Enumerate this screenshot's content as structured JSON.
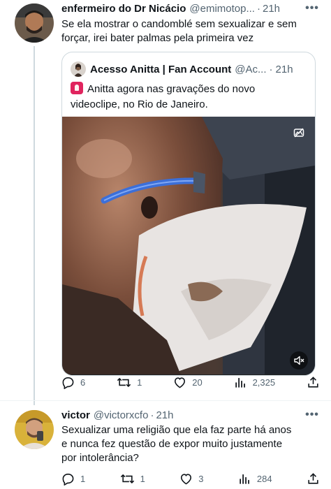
{
  "tweet1": {
    "display_name": "enfermeiro do Dr Nicácio",
    "handle": "@emimotop...",
    "dot": "·",
    "time": "21h",
    "text_line1": "Se ela mostrar o candomblé sem sexualizar e sem",
    "text_line2": "forçar, irei bater palmas pela primeira vez",
    "quote": {
      "display_name": "Acesso Anitta | Fan Account",
      "handle": "@Ac...",
      "dot": "·",
      "time": "21h",
      "text_line1": "Anitta agora nas gravações do novo",
      "text_line2": "videoclipe, no Rio de Janeiro.",
      "emoji_icon": "police-siren-icon"
    },
    "replies": "6",
    "retweets": "1",
    "likes": "20",
    "views": "2,325"
  },
  "tweet2": {
    "display_name": "victor",
    "handle": "@victorxcfo",
    "dot": "·",
    "time": "21h",
    "text_line1": "Sexualizar uma religião que ela faz parte há anos",
    "text_line2": "e nunca fez questão de expor muito justamente",
    "text_line3": "por intolerância?",
    "replies": "1",
    "retweets": "1",
    "likes": "3",
    "views": "284"
  },
  "colors": {
    "text_primary": "#0f1419",
    "text_secondary": "#536471",
    "border": "#cfd9de",
    "sunglasses_blue": "#3b6fd9"
  }
}
